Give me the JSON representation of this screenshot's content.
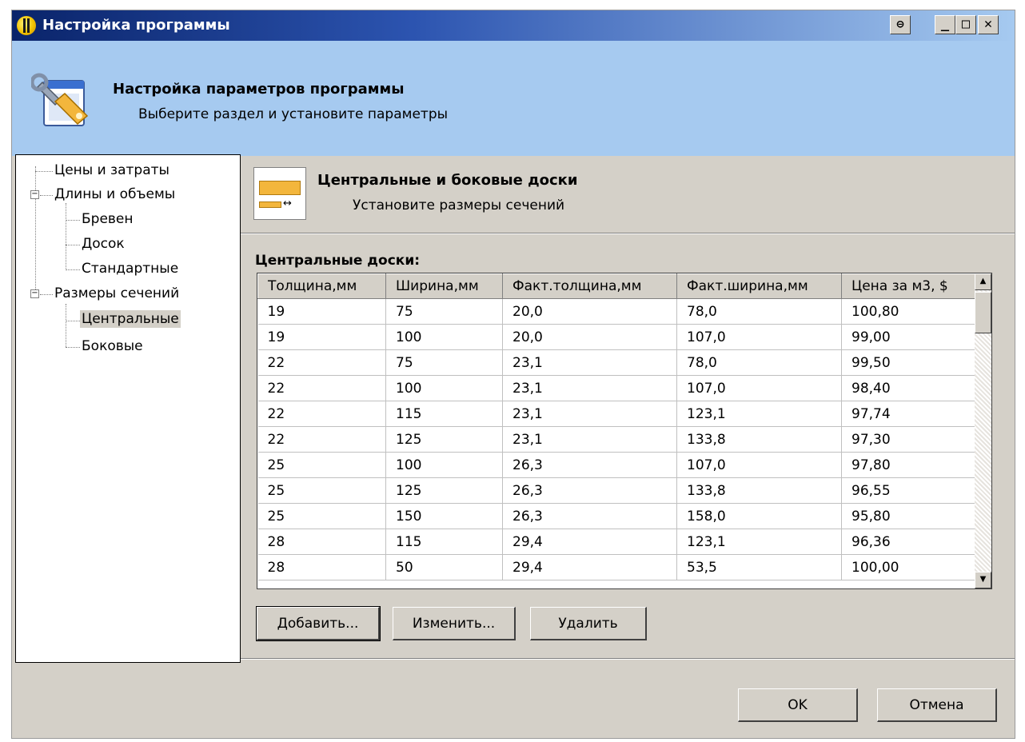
{
  "window": {
    "title": "Настройка программы",
    "controls": {
      "restore": "⊖",
      "minimize": "_",
      "maximize": "□",
      "close": "✕"
    }
  },
  "header": {
    "icon": "settings-wrench-icon",
    "title": "Настройка параметров программы",
    "subtitle": "Выберите раздел и установите параметры"
  },
  "tree": {
    "items": [
      {
        "label": "Цены и затраты"
      },
      {
        "label": "Длины и объемы",
        "expanded": true
      },
      {
        "label": "Бревен"
      },
      {
        "label": "Досок"
      },
      {
        "label": "Стандартные"
      },
      {
        "label": "Размеры сечений",
        "expanded": true
      },
      {
        "label": "Центральные",
        "selected": true
      },
      {
        "label": "Боковые"
      }
    ]
  },
  "section": {
    "icon": "board-section-icon",
    "title": "Центральные и боковые доски",
    "subtitle": "Установите размеры сечений"
  },
  "grid": {
    "label": "Центральные доски:",
    "columns": [
      "Толщина,мм",
      "Ширина,мм",
      "Факт.толщина,мм",
      "Факт.ширина,мм",
      "Цена за м3, $"
    ],
    "rows": [
      [
        "19",
        "75",
        "20,0",
        "78,0",
        "100,80"
      ],
      [
        "19",
        "100",
        "20,0",
        "107,0",
        "99,00"
      ],
      [
        "22",
        "75",
        "23,1",
        "78,0",
        "99,50"
      ],
      [
        "22",
        "100",
        "23,1",
        "107,0",
        "98,40"
      ],
      [
        "22",
        "115",
        "23,1",
        "123,1",
        "97,74"
      ],
      [
        "22",
        "125",
        "23,1",
        "133,8",
        "97,30"
      ],
      [
        "25",
        "100",
        "26,3",
        "107,0",
        "97,80"
      ],
      [
        "25",
        "125",
        "26,3",
        "133,8",
        "96,55"
      ],
      [
        "25",
        "150",
        "26,3",
        "158,0",
        "95,80"
      ],
      [
        "28",
        "115",
        "29,4",
        "123,1",
        "96,36"
      ],
      [
        "28",
        "50",
        "29,4",
        "53,5",
        "100,00"
      ]
    ]
  },
  "buttons": {
    "add": "Добавить...",
    "edit": "Изменить...",
    "delete": "Удалить",
    "ok": "OK",
    "cancel": "Отмена"
  }
}
